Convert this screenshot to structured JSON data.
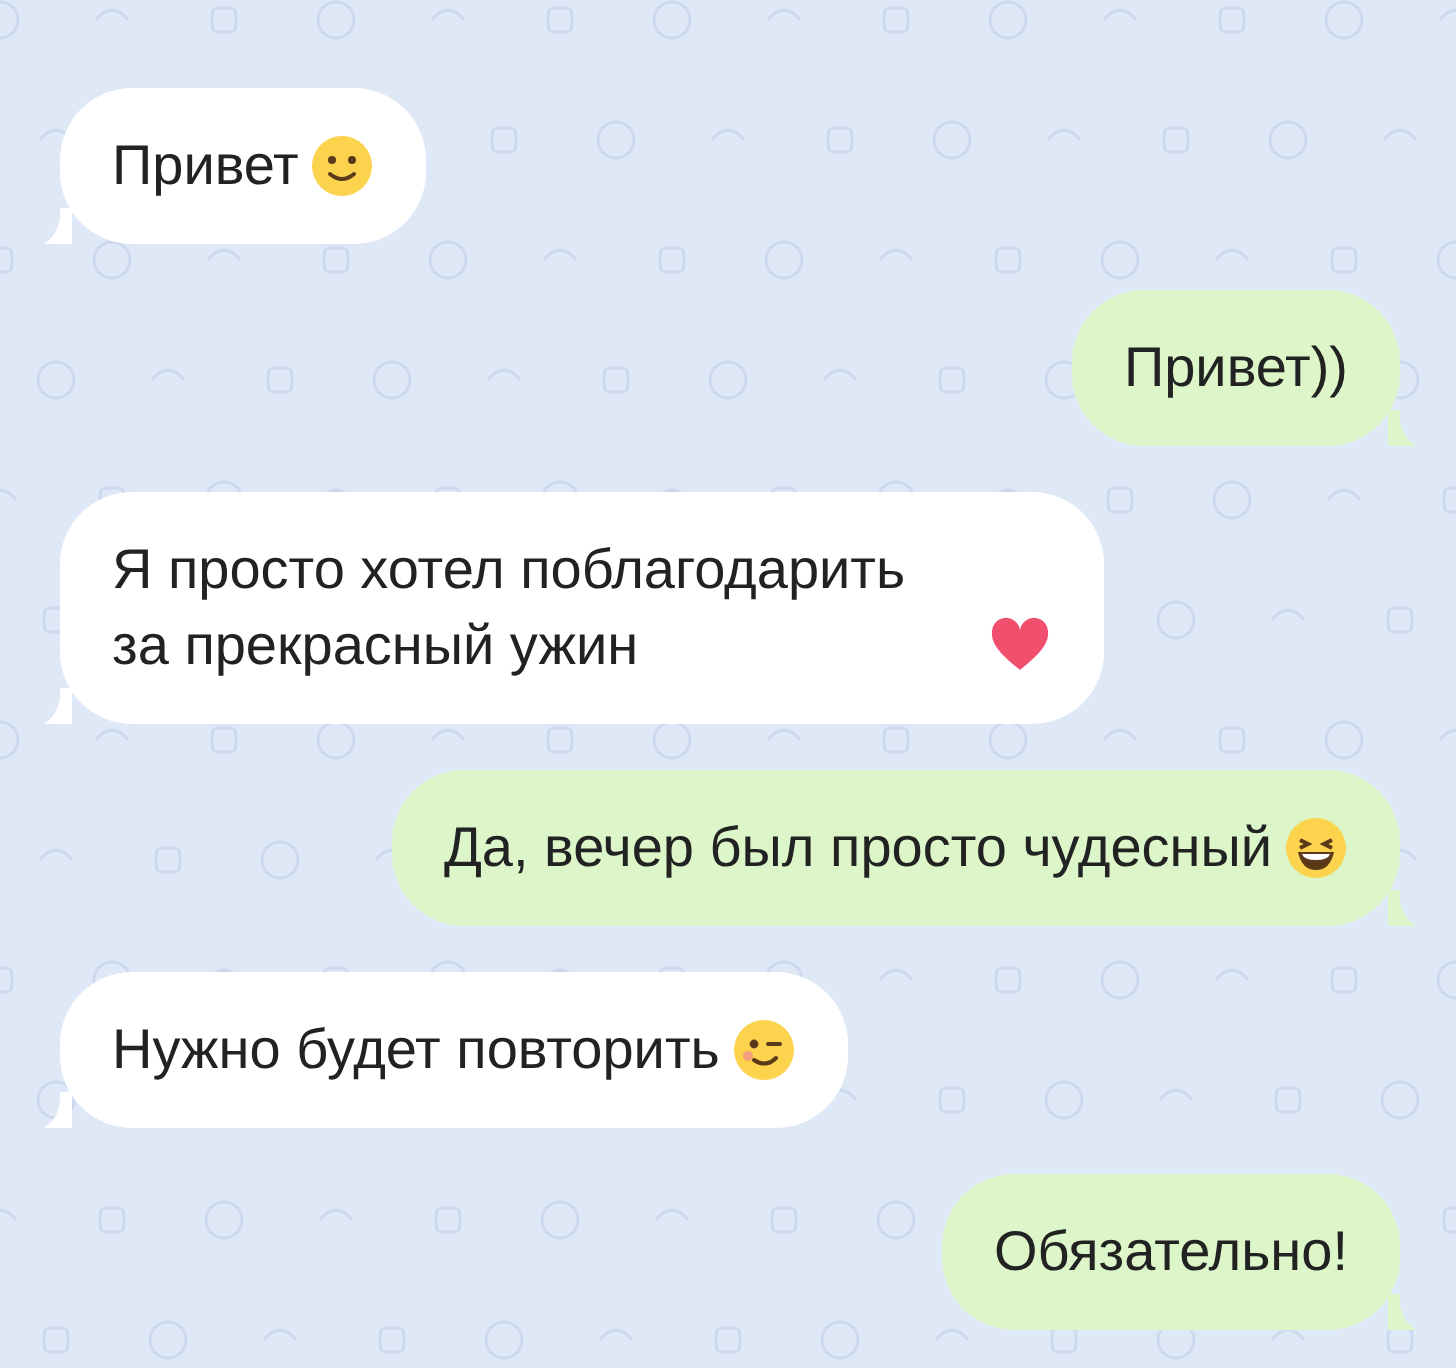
{
  "messages": [
    {
      "outgoing": false,
      "text": "Привет",
      "icon": {
        "kind": "smile"
      }
    },
    {
      "outgoing": true,
      "text": "Привет))"
    },
    {
      "outgoing": false,
      "text": "Я просто хотел поблагодарить за прекрасный ужин",
      "icon": {
        "kind": "heart"
      }
    },
    {
      "outgoing": true,
      "text": "Да, вечер был просто чудесный",
      "icon": {
        "kind": "grin"
      }
    },
    {
      "outgoing": false,
      "text": "Нужно будет повторить",
      "icon": {
        "kind": "wink"
      }
    },
    {
      "outgoing": true,
      "text": "Обязательно!"
    }
  ]
}
